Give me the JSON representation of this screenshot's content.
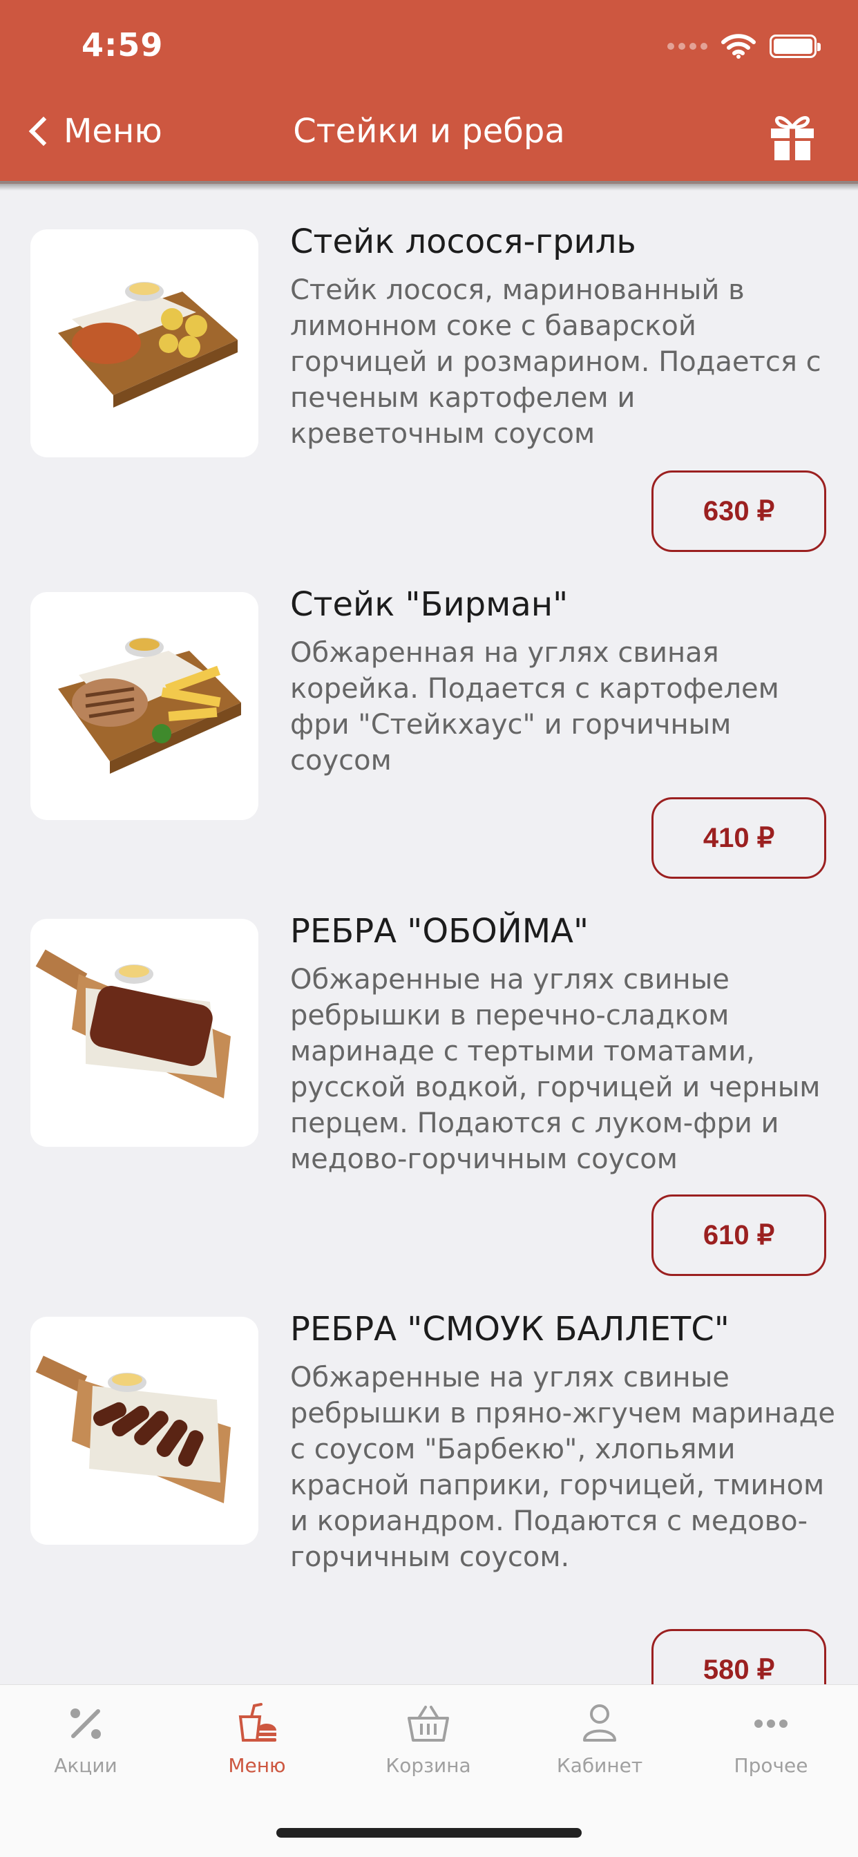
{
  "status": {
    "time": "4:59"
  },
  "header": {
    "back_label": "Меню",
    "title": "Стейки и ребра",
    "gift_icon": "gift-icon"
  },
  "items": [
    {
      "name": "Стейк лосося-гриль",
      "desc": "Стейк лосося, маринованный в лимонном соке с баварской горчицей и розмарином. Подается с печеным картофелем и креветочным соусом",
      "price": "630 ₽"
    },
    {
      "name": "Стейк \"Бирман\"",
      "desc": "Обжаренная на углях свиная корейка. Подается с картофелем фри \"Стейкхаус\" и горчичным соусом",
      "price": "410 ₽"
    },
    {
      "name": "РЕБРА \"ОБОЙМА\"",
      "desc": "Обжаренные на углях свиные ребрышки в перечно-сладком маринаде с тертыми томатами, русской водкой, горчицей и черным перцем. Подаются с луком-фри и медово-горчичным соусом",
      "price": "610 ₽"
    },
    {
      "name": "РЕБРА \"СМОУК БАЛЛЕТС\"",
      "desc": "Обжаренные на углях свиные ребрышки в пряно-жгучем маринаде с соусом \"Барбекю\", хлопьями красной паприки, горчицей, тмином и кориандром. Подаются с медово-горчичным соусом.",
      "price": "580 ₽"
    }
  ],
  "tabbar": {
    "tabs": [
      {
        "label": "Акции",
        "icon": "percent-icon"
      },
      {
        "label": "Меню",
        "icon": "menu-food-icon",
        "active": true
      },
      {
        "label": "Корзина",
        "icon": "basket-icon"
      },
      {
        "label": "Кабинет",
        "icon": "user-icon"
      },
      {
        "label": "Прочее",
        "icon": "more-icon"
      }
    ]
  },
  "colors": {
    "accent": "#cd5740",
    "price": "#9b2020",
    "background": "#f0f0f3"
  }
}
